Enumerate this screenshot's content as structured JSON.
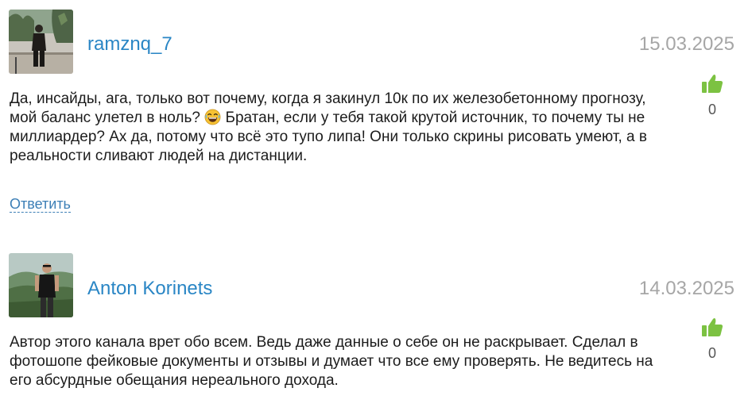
{
  "comments": [
    {
      "username": "ramznq_7",
      "date": "15.03.2025",
      "text_before_emoji": "Да, инсайды, ага, только вот почему, когда я закинул 10к по их железобетонному прогнозу, мой баланс улетел в ноль? ",
      "emoji_icon": "laughing-emoji-icon",
      "text_after_emoji": " Братан, если у тебя такой крутой источник, то почему ты не миллиардер? Ах да, потому что всё это тупо липа! Они только скрины рисовать умеют, а в реальности сливают людей на дистанции.",
      "likes": "0",
      "reply_label": "Ответить"
    },
    {
      "username": "Anton Korinets",
      "date": "14.03.2025",
      "text": "Автор этого канала врет обо всем. Ведь даже данные о себе он не раскрывает. Сделал в фотошопе фейковые документы и отзывы и думает что все ему проверять. Не ведитесь на его абсурдные обещания нереального дохода.",
      "likes": "0"
    }
  ],
  "colors": {
    "username": "#2a86c5",
    "date": "#a6a6a6",
    "like": "#7cc242",
    "reply": "#3d7fb6"
  }
}
